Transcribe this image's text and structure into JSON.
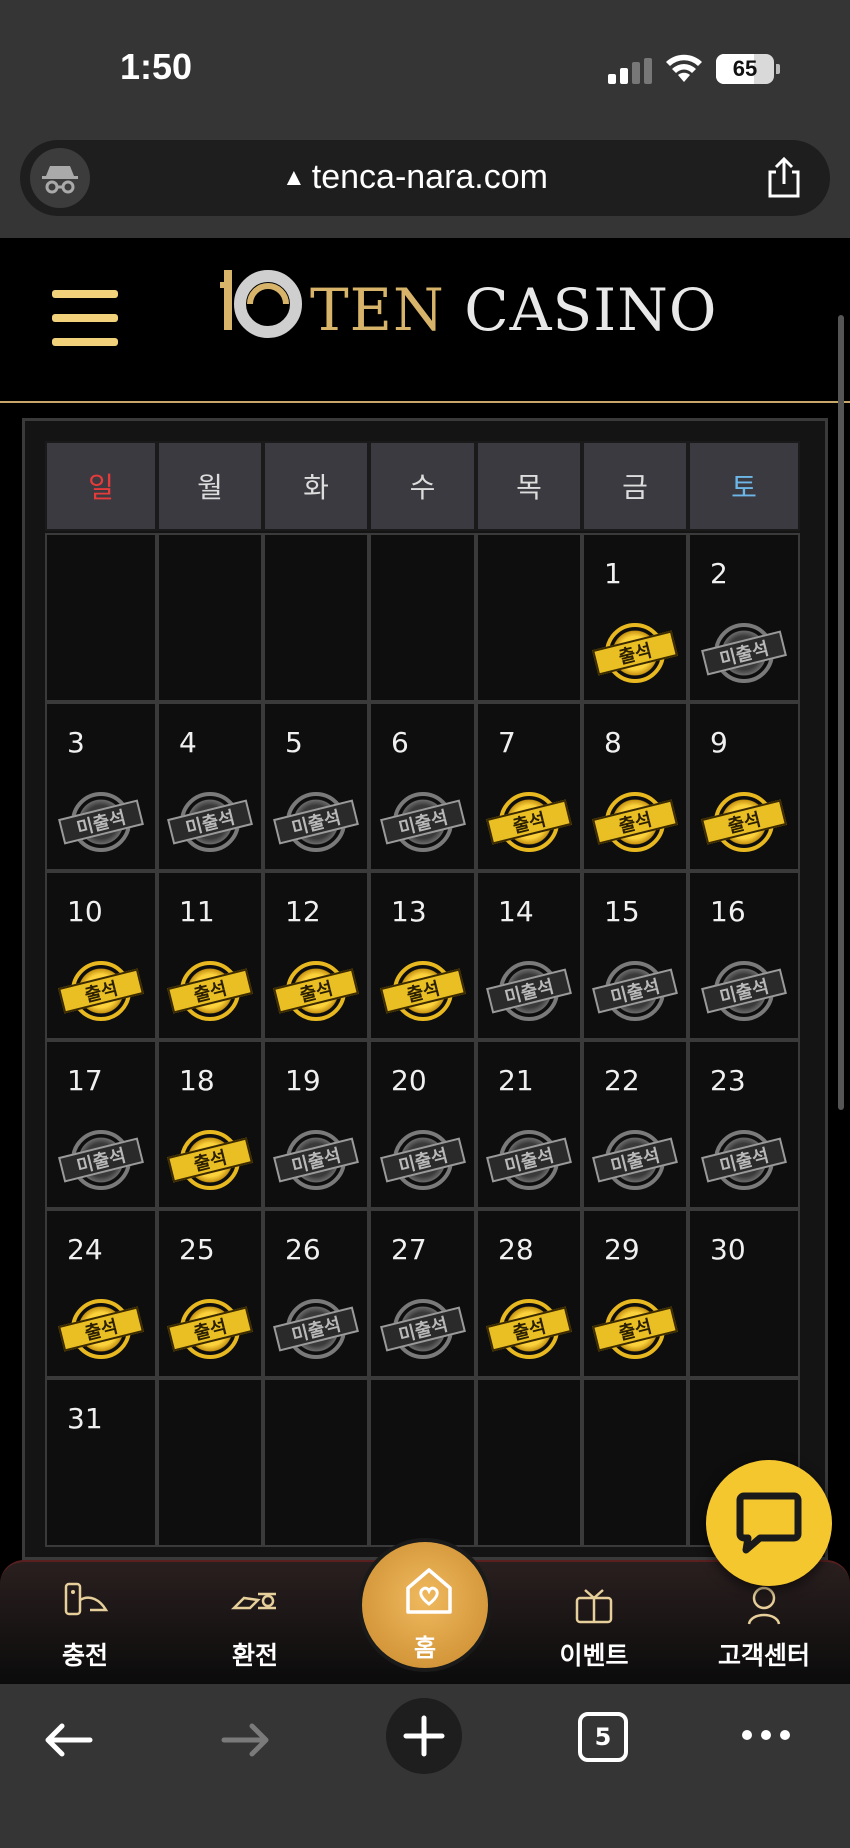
{
  "status_bar": {
    "time": "1:50",
    "battery": "65",
    "battery_level_percent": 65
  },
  "browser": {
    "url": "tenca-nara.com",
    "open_tabs": "5"
  },
  "site": {
    "logo_ten": "TEN",
    "logo_casino": "CASINO"
  },
  "calendar": {
    "weekdays": [
      "일",
      "월",
      "화",
      "수",
      "목",
      "금",
      "토"
    ],
    "stamp_present": "출석",
    "stamp_absent": "미출석",
    "weeks": [
      [
        {
          "d": ""
        },
        {
          "d": ""
        },
        {
          "d": ""
        },
        {
          "d": ""
        },
        {
          "d": ""
        },
        {
          "d": "1",
          "s": "present"
        },
        {
          "d": "2",
          "s": "absent"
        }
      ],
      [
        {
          "d": "3",
          "s": "absent"
        },
        {
          "d": "4",
          "s": "absent"
        },
        {
          "d": "5",
          "s": "absent"
        },
        {
          "d": "6",
          "s": "absent"
        },
        {
          "d": "7",
          "s": "present"
        },
        {
          "d": "8",
          "s": "present"
        },
        {
          "d": "9",
          "s": "present"
        }
      ],
      [
        {
          "d": "10",
          "s": "present"
        },
        {
          "d": "11",
          "s": "present"
        },
        {
          "d": "12",
          "s": "present"
        },
        {
          "d": "13",
          "s": "present"
        },
        {
          "d": "14",
          "s": "absent"
        },
        {
          "d": "15",
          "s": "absent"
        },
        {
          "d": "16",
          "s": "absent"
        }
      ],
      [
        {
          "d": "17",
          "s": "absent"
        },
        {
          "d": "18",
          "s": "present"
        },
        {
          "d": "19",
          "s": "absent"
        },
        {
          "d": "20",
          "s": "absent"
        },
        {
          "d": "21",
          "s": "absent"
        },
        {
          "d": "22",
          "s": "absent"
        },
        {
          "d": "23",
          "s": "absent"
        }
      ],
      [
        {
          "d": "24",
          "s": "present"
        },
        {
          "d": "25",
          "s": "present"
        },
        {
          "d": "26",
          "s": "absent"
        },
        {
          "d": "27",
          "s": "absent"
        },
        {
          "d": "28",
          "s": "present"
        },
        {
          "d": "29",
          "s": "present"
        },
        {
          "d": "30"
        }
      ],
      [
        {
          "d": "31"
        },
        {
          "d": ""
        },
        {
          "d": ""
        },
        {
          "d": ""
        },
        {
          "d": ""
        },
        {
          "d": ""
        },
        {
          "d": ""
        }
      ]
    ]
  },
  "bottom_nav": {
    "charge": "충전",
    "exchange": "환전",
    "home": "홈",
    "event": "이벤트",
    "support": "고객센터"
  },
  "colors": {
    "accent_gold": "#f5c72f",
    "home_button": "#d99a3c",
    "sunday": "#e53b3b",
    "saturday": "#6db7e8"
  }
}
